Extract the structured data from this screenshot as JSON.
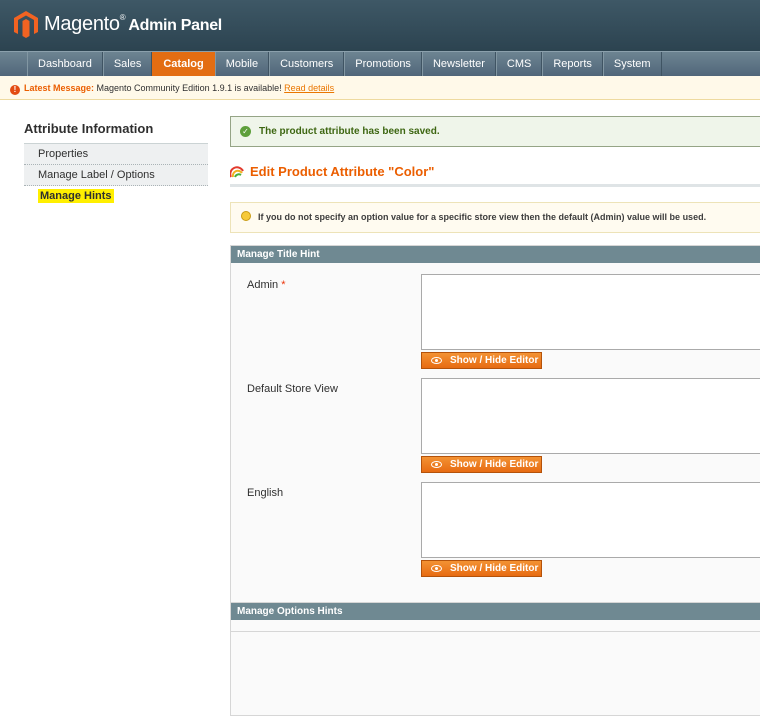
{
  "header": {
    "logo_text": "Magento",
    "logo_sup": "®",
    "logo_admin": "Admin Panel"
  },
  "nav": {
    "items": [
      {
        "label": "Dashboard"
      },
      {
        "label": "Sales"
      },
      {
        "label": "Catalog",
        "active": true
      },
      {
        "label": "Mobile"
      },
      {
        "label": "Customers"
      },
      {
        "label": "Promotions"
      },
      {
        "label": "Newsletter"
      },
      {
        "label": "CMS"
      },
      {
        "label": "Reports"
      },
      {
        "label": "System"
      }
    ]
  },
  "message_bar": {
    "prefix": "Latest Message:",
    "text": " Magento Community Edition 1.9.1 is available! ",
    "link": "Read details"
  },
  "sidebar": {
    "title": "Attribute Information",
    "items": [
      {
        "label": "Properties"
      },
      {
        "label": "Manage Label / Options"
      },
      {
        "label": "Manage Hints",
        "active": true
      }
    ]
  },
  "main": {
    "success_message": "The product attribute has been saved.",
    "page_title": "Edit Product Attribute \"Color\"",
    "notice": "If you do not specify an option value for a specific store view then the default (Admin) value will be used.",
    "title_hint": {
      "header": "Manage Title Hint",
      "rows": [
        {
          "label": "Admin",
          "required": "*",
          "value": "",
          "button": "Show / Hide Editor"
        },
        {
          "label": "Default Store View",
          "value": "",
          "button": "Show / Hide Editor"
        },
        {
          "label": "English",
          "value": "",
          "button": "Show / Hide Editor"
        }
      ]
    },
    "options_hints": {
      "header": "Manage Options Hints"
    }
  },
  "colors": {
    "accent": "#eb5e00",
    "nav_active": "#e36d12",
    "header_bg": "#2c4350",
    "fieldset_header": "#6f8992"
  }
}
